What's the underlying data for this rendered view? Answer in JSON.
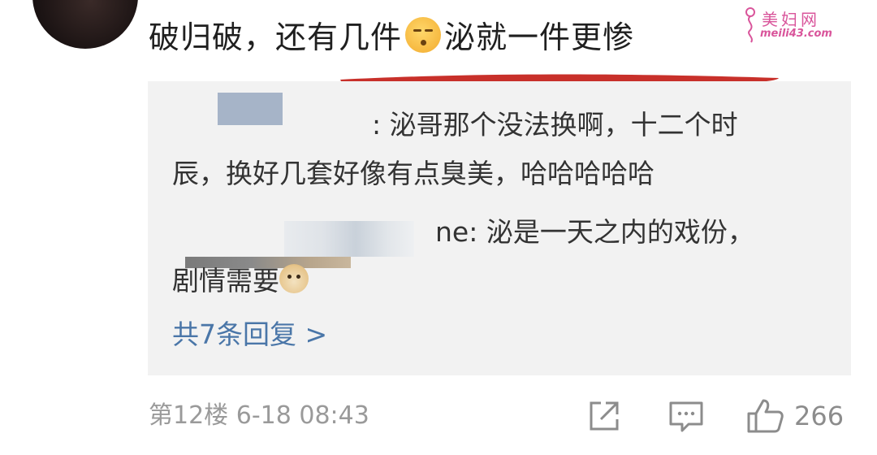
{
  "comment": {
    "text_before": "破归破，还有几件",
    "emoji": "shushing-face-emoji",
    "text_after": "泌就一件更惨"
  },
  "watermark": {
    "brand": "美妇网",
    "url": "meili43.com"
  },
  "replies": [
    {
      "author_visible": "",
      "text_line1": ": 泌哥那个没法换啊，十二个时",
      "text_line2": "辰，换好几套好像有点臭美，哈哈哈哈哈"
    },
    {
      "author_visible": "ne",
      "text_line1": ": 泌是一天之内的戏份，",
      "text_line2": "剧情需要",
      "emoji": "doge-emoji"
    }
  ],
  "more_replies_label": "共7条回复 >",
  "meta": {
    "floor": "第12楼",
    "timestamp": "6-18 08:43"
  },
  "actions": {
    "share_icon": "share-icon",
    "comment_icon": "comment-icon",
    "like_icon": "thumbs-up-icon",
    "like_count": "266"
  },
  "colors": {
    "underline": "#c8302a",
    "link": "#4a76a8",
    "reply_bg": "#f2f2f2",
    "meta_text": "#9a9a9a"
  }
}
